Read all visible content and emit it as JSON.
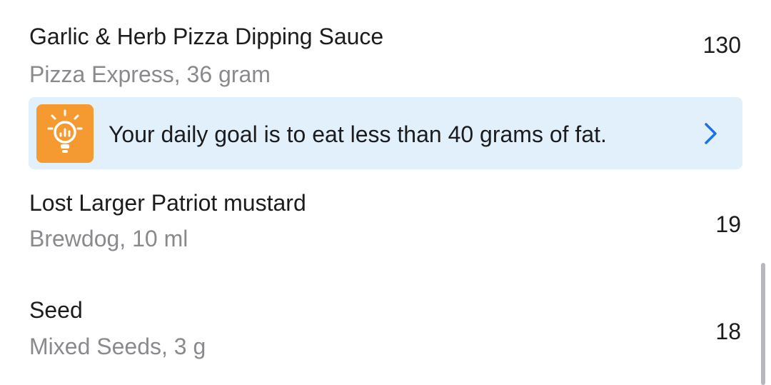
{
  "foods": [
    {
      "name": "Garlic & Herb Pizza Dipping Sauce",
      "detail": "Pizza Express, 36 gram",
      "calories": "130"
    },
    {
      "name": "Lost Larger Patriot mustard",
      "detail": "Brewdog, 10 ml",
      "calories": "19"
    },
    {
      "name": "Seed",
      "detail": "Mixed Seeds, 3 g",
      "calories": "18"
    }
  ],
  "tip": {
    "text": "Your daily goal is to eat less than 40 grams of fat.",
    "icon": "lightbulb-chart-icon",
    "action_icon": "chevron-right-icon",
    "background_color": "#e1f0fb",
    "icon_color": "#f59a30",
    "accent_color": "#1a73e8"
  }
}
